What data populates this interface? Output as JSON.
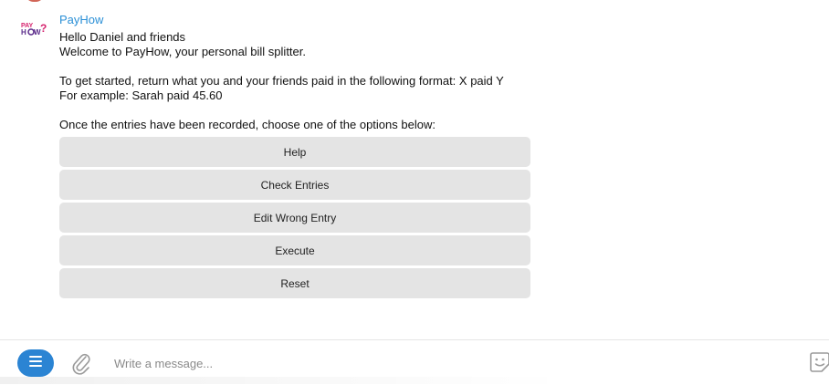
{
  "message": {
    "sender": "PayHow",
    "avatar_icon": "payhow-logo-icon",
    "lines": {
      "greeting": "Hello Daniel and friends",
      "welcome": "Welcome to PayHow, your personal bill splitter.",
      "instructions": "To get started, return what you and your friends paid in the following format: X paid Y",
      "example": "For example: Sarah paid 45.60",
      "options_prompt": "Once the entries have been recorded, choose one of the options below:"
    }
  },
  "keyboard": {
    "buttons": [
      {
        "label": "Help"
      },
      {
        "label": "Check Entries"
      },
      {
        "label": "Edit Wrong Entry"
      },
      {
        "label": "Execute"
      },
      {
        "label": "Reset"
      }
    ]
  },
  "composer": {
    "placeholder": "Write a message...",
    "menu_icon": "menu-icon",
    "attach_icon": "paperclip-icon",
    "sticker_icon": "sticker-icon",
    "accent_color": "#2b84d3"
  },
  "colors": {
    "sender_name": "#2a8fd6",
    "button_bg": "#e4e4e4"
  }
}
